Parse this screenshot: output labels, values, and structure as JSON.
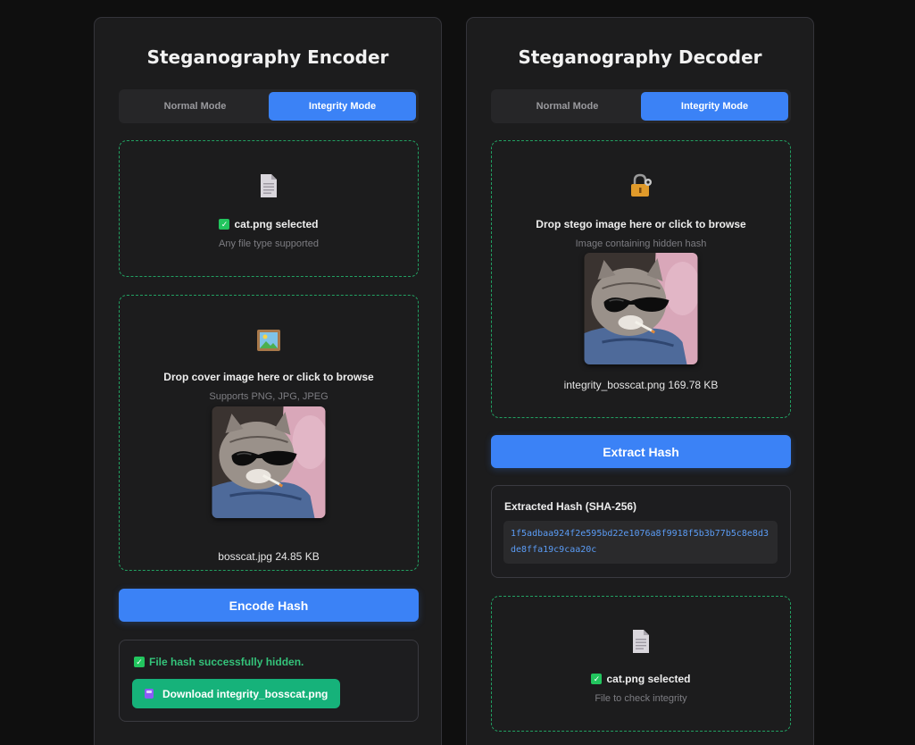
{
  "encoder": {
    "title": "Steganography Encoder",
    "modes": [
      "Normal Mode",
      "Integrity Mode"
    ],
    "active_mode": "Integrity Mode",
    "file_drop": {
      "icon": "document-icon",
      "title": "cat.png selected",
      "subtitle": "Any file type supported"
    },
    "cover_drop": {
      "icon": "picture-icon",
      "title": "Drop cover image here or click to browse",
      "subtitle": "Supports PNG, JPG, JPEG",
      "file_name": "bosscat.jpg",
      "file_size": "24.85 KB"
    },
    "encode_button": "Encode Hash",
    "result": {
      "message": "File hash successfully hidden.",
      "download_label": "Download integrity_bosscat.png"
    }
  },
  "decoder": {
    "title": "Steganography Decoder",
    "modes": [
      "Normal Mode",
      "Integrity Mode"
    ],
    "active_mode": "Integrity Mode",
    "stego_drop": {
      "icon": "lock-key-icon",
      "title": "Drop stego image here or click to browse",
      "subtitle": "Image containing hidden hash",
      "file_name": "integrity_bosscat.png",
      "file_size": "169.78 KB"
    },
    "extract_button": "Extract Hash",
    "hash_result": {
      "label": "Extracted Hash (SHA-256)",
      "value": "1f5adbaa924f2e595bd22e1076a8f9918f5b3b77b5c8e8d3de8ffa19c9caa20c"
    },
    "check_drop": {
      "icon": "document-icon",
      "title": "cat.png selected",
      "subtitle": "File to check integrity"
    }
  },
  "colors": {
    "accent": "#3b82f6",
    "success": "#22c55e",
    "download": "#16b27a",
    "dashed_border": "#22a062",
    "background": "#0f0f0f",
    "panel": "#1c1c1d"
  }
}
